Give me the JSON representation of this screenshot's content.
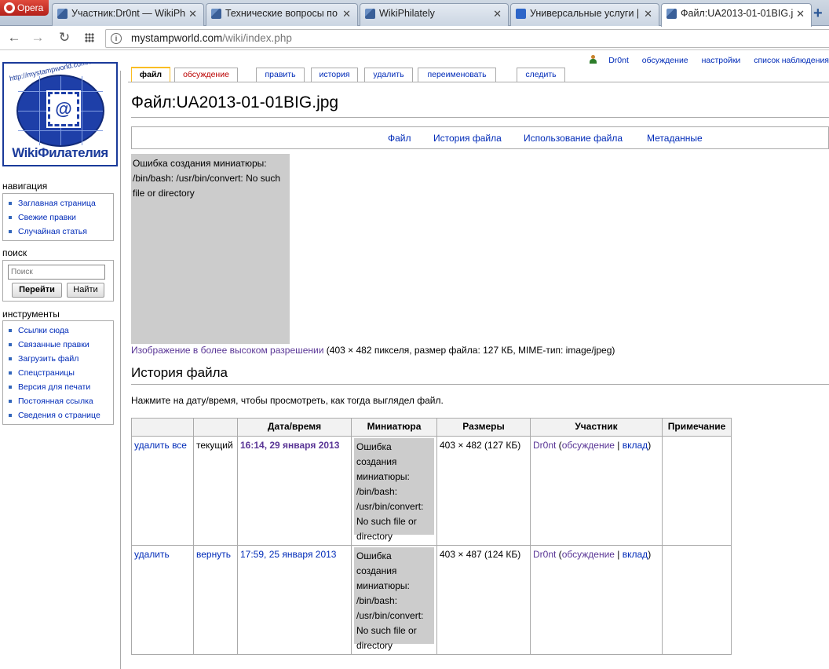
{
  "browser": {
    "menu_label": "Opera",
    "tabs": [
      {
        "title": "Участник:Dr0nt — WikiPh",
        "close": "✕"
      },
      {
        "title": "Технические вопросы по",
        "close": "✕"
      },
      {
        "title": "WikiPhilately",
        "close": "✕"
      },
      {
        "title": "Универсальные услуги |",
        "close": "✕"
      },
      {
        "title": "Файл:UA2013-01-01BIG.j",
        "close": "✕"
      }
    ],
    "new_tab": "+",
    "url_host": "mystampworld.com",
    "url_path": "/wiki/index.php"
  },
  "logo": {
    "arc_text": "http://mystampworld.com/wiki",
    "at_symbol": "@",
    "name": "WikiФилателия"
  },
  "personal": {
    "user": "Dr0nt",
    "talk": "обсуждение",
    "settings": "настройки",
    "watchlist": "список наблюдения"
  },
  "content_tabs": {
    "file": "файл",
    "discussion": "обсуждение",
    "edit": "править",
    "history": "история",
    "delete": "удалить",
    "rename": "переименовать",
    "watch": "следить"
  },
  "sidebar": {
    "navigation": {
      "heading": "навигация",
      "items": [
        "Заглавная страница",
        "Свежие правки",
        "Случайная статья"
      ]
    },
    "search": {
      "heading": "поиск",
      "placeholder": "Поиск",
      "go": "Перейти",
      "find": "Найти"
    },
    "tools": {
      "heading": "инструменты",
      "items": [
        "Ссылки сюда",
        "Связанные правки",
        "Загрузить файл",
        "Спецстраницы",
        "Версия для печати",
        "Постоянная ссылка",
        "Сведения о странице"
      ]
    }
  },
  "page": {
    "title": "Файл:UA2013-01-01BIG.jpg",
    "toc": [
      "Файл",
      "История файла",
      "Использование файла",
      "Метаданные"
    ],
    "thumb_error": "Ошибка создания миниатюры: /bin/bash: /usr/bin/convert: No such file or directory",
    "hires_link": "Изображение в более высоком разрешении",
    "hires_info": " (403 × 482 пикселя, размер файла: 127 КБ, MIME-тип: image/jpeg)",
    "history_heading": "История файла",
    "history_intro": "Нажмите на дату/время, чтобы просмотреть, как тогда выглядел файл."
  },
  "history_table": {
    "headers": [
      "",
      "",
      "Дата/время",
      "Миниатюра",
      "Размеры",
      "Участник",
      "Примечание"
    ],
    "rows": [
      {
        "action": "удалить все",
        "state": "текущий",
        "datetime": "16:14, 29 января 2013",
        "thumb": "Ошибка создания миниатюры: /bin/bash: /usr/bin/convert: No such file or directory",
        "size": "403 × 482 (127 КБ)",
        "user": "Dr0nt",
        "talk": "обсуждение",
        "contrib": "вклад",
        "note": ""
      },
      {
        "action": "удалить",
        "state": "вернуть",
        "datetime": "17:59, 25 января 2013",
        "thumb": "Ошибка создания миниатюры: /bin/bash: /usr/bin/convert: No such file or directory",
        "size": "403 × 487 (124 КБ)",
        "user": "Dr0nt",
        "talk": "обсуждение",
        "contrib": "вклад",
        "note": ""
      }
    ]
  }
}
